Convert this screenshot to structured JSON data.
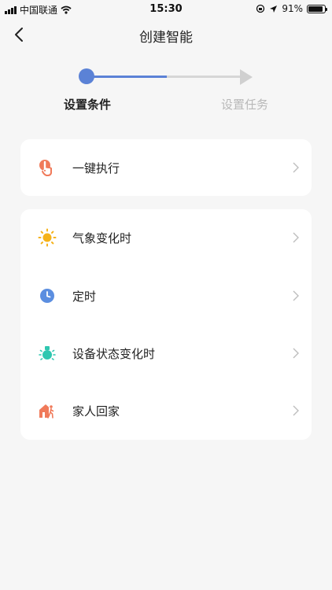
{
  "status_bar": {
    "carrier": "中国联通",
    "time": "15:30",
    "battery_percent": "91%",
    "battery_level": 0.91
  },
  "nav": {
    "title": "创建智能",
    "back_icon": "chevron-left-icon"
  },
  "stepper": {
    "steps": [
      {
        "label": "设置条件",
        "active": true
      },
      {
        "label": "设置任务",
        "active": false
      }
    ],
    "active_color": "#5b82d6",
    "inactive_color": "#d0d0d0"
  },
  "conditions": {
    "manual": [
      {
        "label": "一键执行",
        "icon": "tap-hand-icon",
        "color": "#f07a5a"
      }
    ],
    "auto": [
      {
        "label": "气象变化时",
        "icon": "sun-icon",
        "color": "#f5b21a"
      },
      {
        "label": "定时",
        "icon": "clock-icon",
        "color": "#5b8ee0"
      },
      {
        "label": "设备状态变化时",
        "icon": "device-light-icon",
        "color": "#2fc7b0"
      },
      {
        "label": "家人回家",
        "icon": "home-walk-icon",
        "color": "#f07a5a"
      }
    ]
  }
}
